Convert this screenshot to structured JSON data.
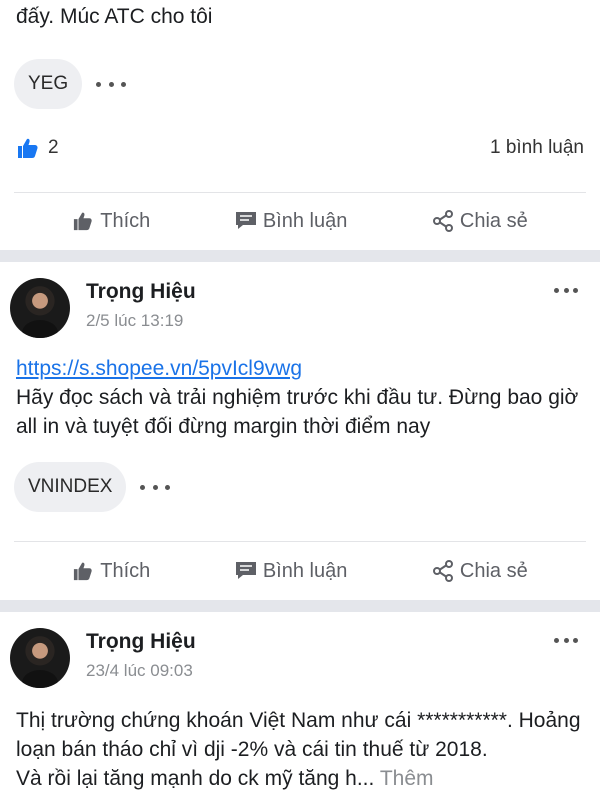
{
  "post1": {
    "text_tail": "đấy. Múc ATC cho tôi",
    "tag": "YEG",
    "like_count": "2",
    "comment_count": "1 bình luận"
  },
  "actions": {
    "like": "Thích",
    "comment": "Bình luận",
    "share": "Chia sẻ"
  },
  "post2": {
    "author": "Trọng Hiệu",
    "time": "2/5 lúc 13:19",
    "link": "https://s.shopee.vn/5pvIcl9vwg",
    "text": "Hãy đọc sách và trải nghiệm trước khi đầu tư. Đừng bao giờ all in và tuyệt đối đừng margin thời điểm nay",
    "tag": "VNINDEX"
  },
  "post3": {
    "author": "Trọng Hiệu",
    "time": "23/4 lúc 09:03",
    "text": "Thị trường chứng khoán Việt Nam như cái ***********. Hoảng loạn bán tháo chỉ vì dji -2% và cái tin thuế từ 2018.",
    "text_cut": "Và rồi lại tăng mạnh do ck mỹ tăng h...",
    "more_label": "Thêm"
  },
  "icons": {
    "like": "thumbs-up-icon",
    "comment": "comment-bubble-icon",
    "share": "share-icon",
    "more": "more-dots-icon"
  },
  "colors": {
    "link": "#1a73e8",
    "like_blue": "#1877f2",
    "separator": "#e4e6eb"
  }
}
